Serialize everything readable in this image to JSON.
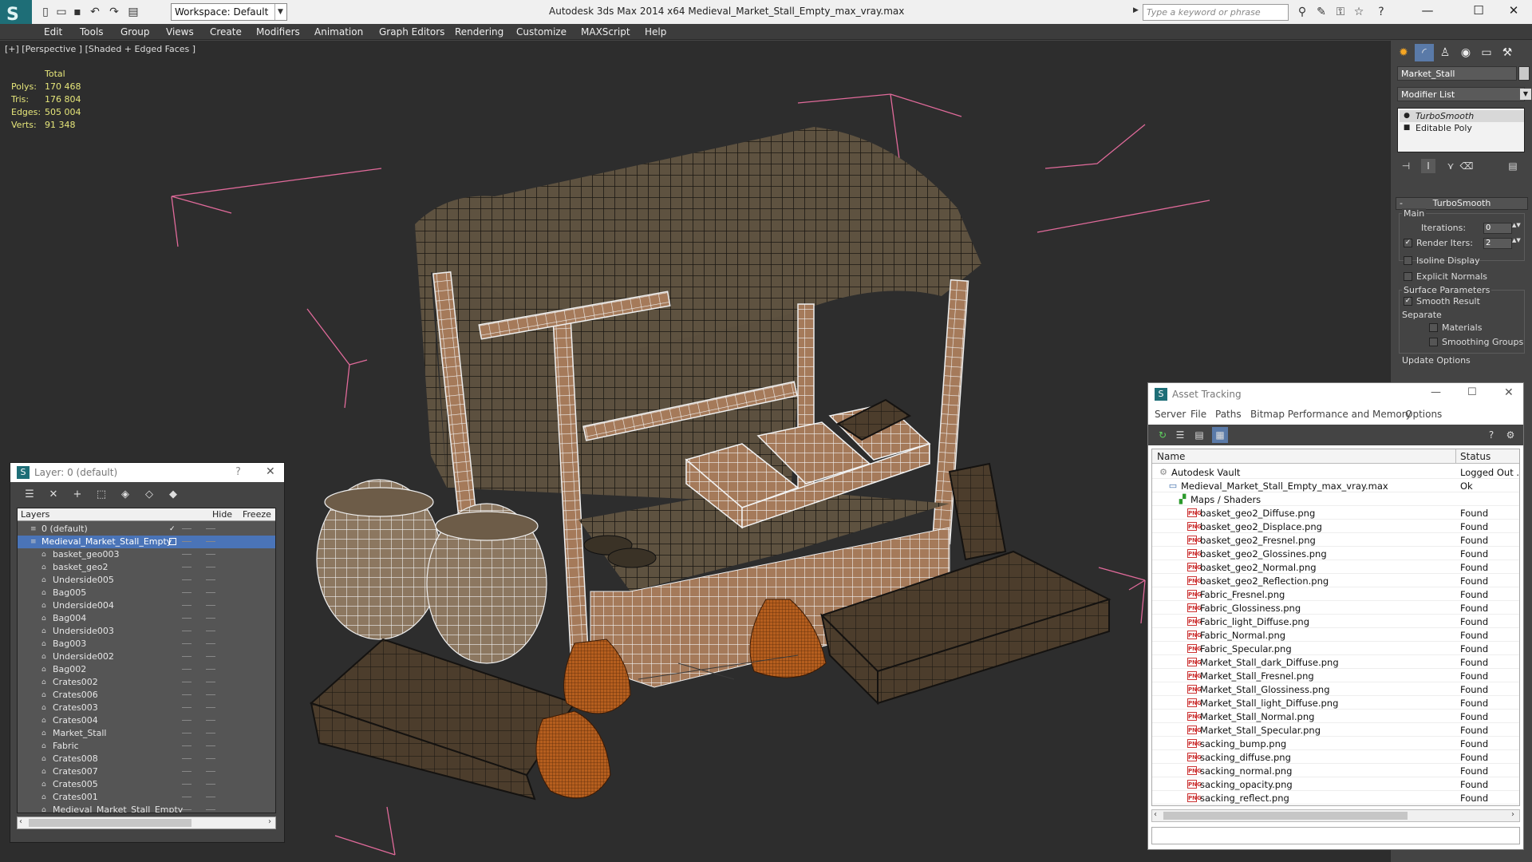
{
  "title_bar": {
    "app_title": "Autodesk 3ds Max  2014 x64     Medieval_Market_Stall_Empty_max_vray.max",
    "workspace": "Workspace: Default",
    "search_placeholder": "Type a keyword or phrase"
  },
  "menu": [
    "Edit",
    "Tools",
    "Group",
    "Views",
    "Create",
    "Modifiers",
    "Animation",
    "Graph Editors",
    "Rendering",
    "Customize",
    "MAXScript",
    "Help"
  ],
  "viewport": {
    "label": "[+] [Perspective ] [Shaded + Edged Faces ]",
    "stats": {
      "header": "Total",
      "rows": [
        {
          "key": "Polys:",
          "value": "170 468"
        },
        {
          "key": "Tris:",
          "value": "176 804"
        },
        {
          "key": "Edges:",
          "value": "505 004"
        },
        {
          "key": "Verts:",
          "value": "91 348"
        }
      ]
    }
  },
  "command_panel": {
    "object_name": "Market_Stall",
    "modifier_list": "Modifier List",
    "stack": [
      "TurboSmooth",
      "Editable Poly"
    ],
    "turbosmooth": {
      "title": "TurboSmooth",
      "main_group": "Main",
      "iterations_label": "Iterations:",
      "iterations_value": "0",
      "render_iters_label": "Render Iters:",
      "render_iters_value": "2",
      "isoline": "Isoline Display",
      "explicit_normals": "Explicit Normals",
      "surface_group": "Surface Parameters",
      "smooth_result": "Smooth Result",
      "separate": "Separate",
      "materials": "Materials",
      "smoothing_groups": "Smoothing Groups",
      "update_options": "Update Options"
    }
  },
  "layer_window": {
    "title": "Layer: 0 (default)",
    "help": "?",
    "columns": {
      "layers": "Layers",
      "hide": "Hide",
      "freeze": "Freeze"
    },
    "rows": [
      {
        "name": "0 (default)",
        "level": 1,
        "checked": true
      },
      {
        "name": "Medieval_Market_Stall_Empty",
        "level": 1,
        "selected": true
      },
      {
        "name": "basket_geo003",
        "level": 2
      },
      {
        "name": "basket_geo2",
        "level": 2
      },
      {
        "name": "Underside005",
        "level": 2
      },
      {
        "name": "Bag005",
        "level": 2
      },
      {
        "name": "Underside004",
        "level": 2
      },
      {
        "name": "Bag004",
        "level": 2
      },
      {
        "name": "Underside003",
        "level": 2
      },
      {
        "name": "Bag003",
        "level": 2
      },
      {
        "name": "Underside002",
        "level": 2
      },
      {
        "name": "Bag002",
        "level": 2
      },
      {
        "name": "Crates002",
        "level": 2
      },
      {
        "name": "Crates006",
        "level": 2
      },
      {
        "name": "Crates003",
        "level": 2
      },
      {
        "name": "Crates004",
        "level": 2
      },
      {
        "name": "Market_Stall",
        "level": 2
      },
      {
        "name": "Fabric",
        "level": 2
      },
      {
        "name": "Crates008",
        "level": 2
      },
      {
        "name": "Crates007",
        "level": 2
      },
      {
        "name": "Crates005",
        "level": 2
      },
      {
        "name": "Crates001",
        "level": 2
      },
      {
        "name": "Medieval_Market_Stall_Empty",
        "level": 2
      }
    ]
  },
  "asset_window": {
    "title": "Asset Tracking",
    "menu": [
      "Server",
      "File",
      "Paths",
      "Bitmap Performance and Memory",
      "Options"
    ],
    "columns": {
      "name": "Name",
      "status": "Status"
    },
    "rows": [
      {
        "name": "Autodesk Vault",
        "status": "Logged Out ...",
        "level": 0,
        "icon": "vault"
      },
      {
        "name": "Medieval_Market_Stall_Empty_max_vray.max",
        "status": "Ok",
        "level": 1,
        "icon": "max"
      },
      {
        "name": "Maps / Shaders",
        "status": "",
        "level": 2,
        "icon": "maps"
      },
      {
        "name": "basket_geo2_Diffuse.png",
        "status": "Found",
        "level": 3,
        "icon": "png"
      },
      {
        "name": "basket_geo2_Displace.png",
        "status": "Found",
        "level": 3,
        "icon": "png"
      },
      {
        "name": "basket_geo2_Fresnel.png",
        "status": "Found",
        "level": 3,
        "icon": "png"
      },
      {
        "name": "basket_geo2_Glossines.png",
        "status": "Found",
        "level": 3,
        "icon": "png"
      },
      {
        "name": "basket_geo2_Normal.png",
        "status": "Found",
        "level": 3,
        "icon": "png"
      },
      {
        "name": "basket_geo2_Reflection.png",
        "status": "Found",
        "level": 3,
        "icon": "png"
      },
      {
        "name": "Fabric_Fresnel.png",
        "status": "Found",
        "level": 3,
        "icon": "png"
      },
      {
        "name": "Fabric_Glossiness.png",
        "status": "Found",
        "level": 3,
        "icon": "png"
      },
      {
        "name": "Fabric_light_Diffuse.png",
        "status": "Found",
        "level": 3,
        "icon": "png"
      },
      {
        "name": "Fabric_Normal.png",
        "status": "Found",
        "level": 3,
        "icon": "png"
      },
      {
        "name": "Fabric_Specular.png",
        "status": "Found",
        "level": 3,
        "icon": "png"
      },
      {
        "name": "Market_Stall_dark_Diffuse.png",
        "status": "Found",
        "level": 3,
        "icon": "png"
      },
      {
        "name": "Market_Stall_Fresnel.png",
        "status": "Found",
        "level": 3,
        "icon": "png"
      },
      {
        "name": "Market_Stall_Glossiness.png",
        "status": "Found",
        "level": 3,
        "icon": "png"
      },
      {
        "name": "Market_Stall_light_Diffuse.png",
        "status": "Found",
        "level": 3,
        "icon": "png"
      },
      {
        "name": "Market_Stall_Normal.png",
        "status": "Found",
        "level": 3,
        "icon": "png"
      },
      {
        "name": "Market_Stall_Specular.png",
        "status": "Found",
        "level": 3,
        "icon": "png"
      },
      {
        "name": "sacking_bump.png",
        "status": "Found",
        "level": 3,
        "icon": "png"
      },
      {
        "name": "sacking_diffuse.png",
        "status": "Found",
        "level": 3,
        "icon": "png"
      },
      {
        "name": "sacking_normal.png",
        "status": "Found",
        "level": 3,
        "icon": "png"
      },
      {
        "name": "sacking_opacity.png",
        "status": "Found",
        "level": 3,
        "icon": "png"
      },
      {
        "name": "sacking_reflect.png",
        "status": "Found",
        "level": 3,
        "icon": "png"
      }
    ]
  },
  "colors": {
    "viewport_bg": "#2d2d2d",
    "panel_bg": "#444444",
    "selection": "#4a74b8",
    "stats_text": "#e6e67a",
    "bbox": "#e06a9a"
  }
}
